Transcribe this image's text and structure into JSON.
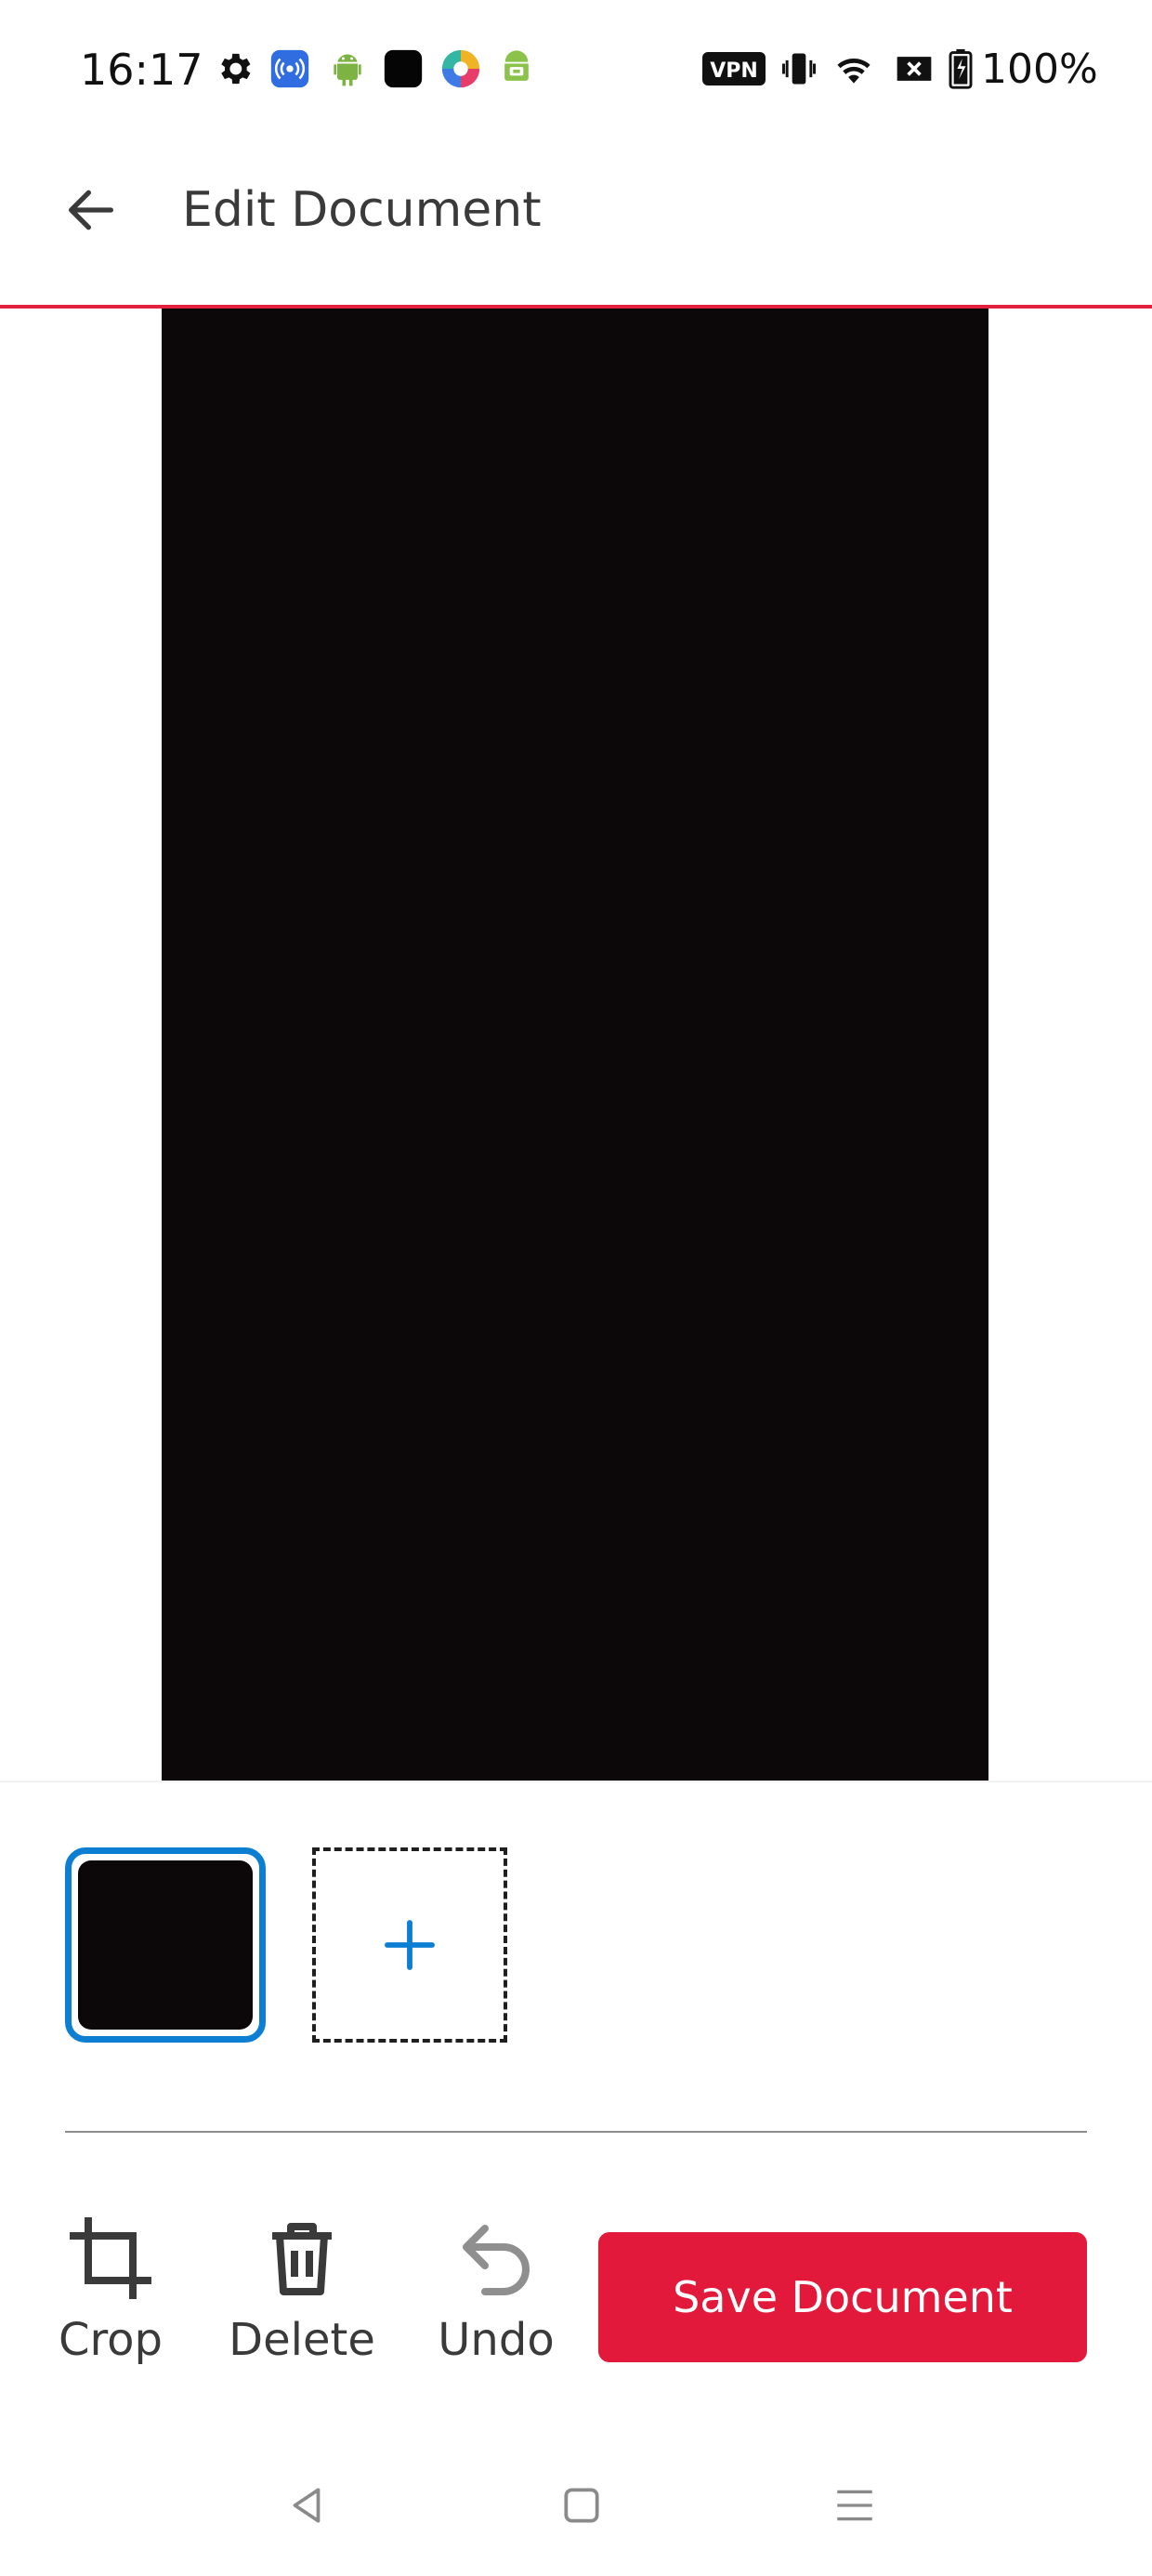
{
  "status_bar": {
    "time": "16:17",
    "icons": [
      "gear-icon",
      "broadcast-icon",
      "android-icon",
      "black-square-app-icon",
      "colorful-app-icon",
      "android-robot-icon",
      "vpn-icon",
      "vibrate-icon",
      "wifi-icon",
      "no-sim-icon",
      "battery-icon"
    ],
    "vpn_label": "VPN",
    "battery": "100%"
  },
  "header": {
    "title": "Edit Document",
    "accent_color": "#e2213f"
  },
  "pages": {
    "selected_index": 0,
    "count": 1,
    "selected_border_color": "#0d7fd3"
  },
  "toolbar": {
    "crop_label": "Crop",
    "delete_label": "Delete",
    "undo_label": "Undo",
    "save_label": "Save Document",
    "save_color": "#e2193b"
  },
  "nav_bar": {
    "icons": [
      "back-triangle-icon",
      "home-square-icon",
      "menu-lines-icon"
    ]
  }
}
